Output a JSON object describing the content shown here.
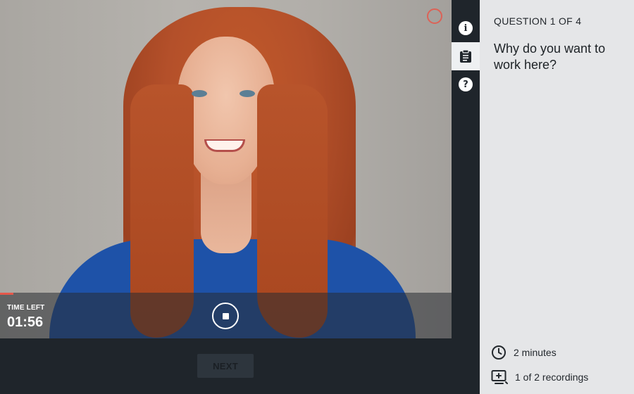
{
  "video": {
    "time_left_label": "TIME LEFT",
    "time_left_value": "01:56",
    "progress_fraction": 0.03,
    "record_indicator_color": "#e5574a"
  },
  "footer": {
    "next_label": "NEXT"
  },
  "rail": {
    "items": [
      {
        "icon": "info-icon",
        "active": false
      },
      {
        "icon": "clipboard-icon",
        "active": true
      },
      {
        "icon": "help-icon",
        "active": false
      }
    ]
  },
  "panel": {
    "question_count": "QUESTION 1 OF 4",
    "question_text": "Why do you want to work here?",
    "duration": "2 minutes",
    "recordings": "1 of 2 recordings"
  },
  "colors": {
    "accent": "#e5574a",
    "dark": "#1f252b",
    "panel_bg": "#e5e6e8"
  }
}
